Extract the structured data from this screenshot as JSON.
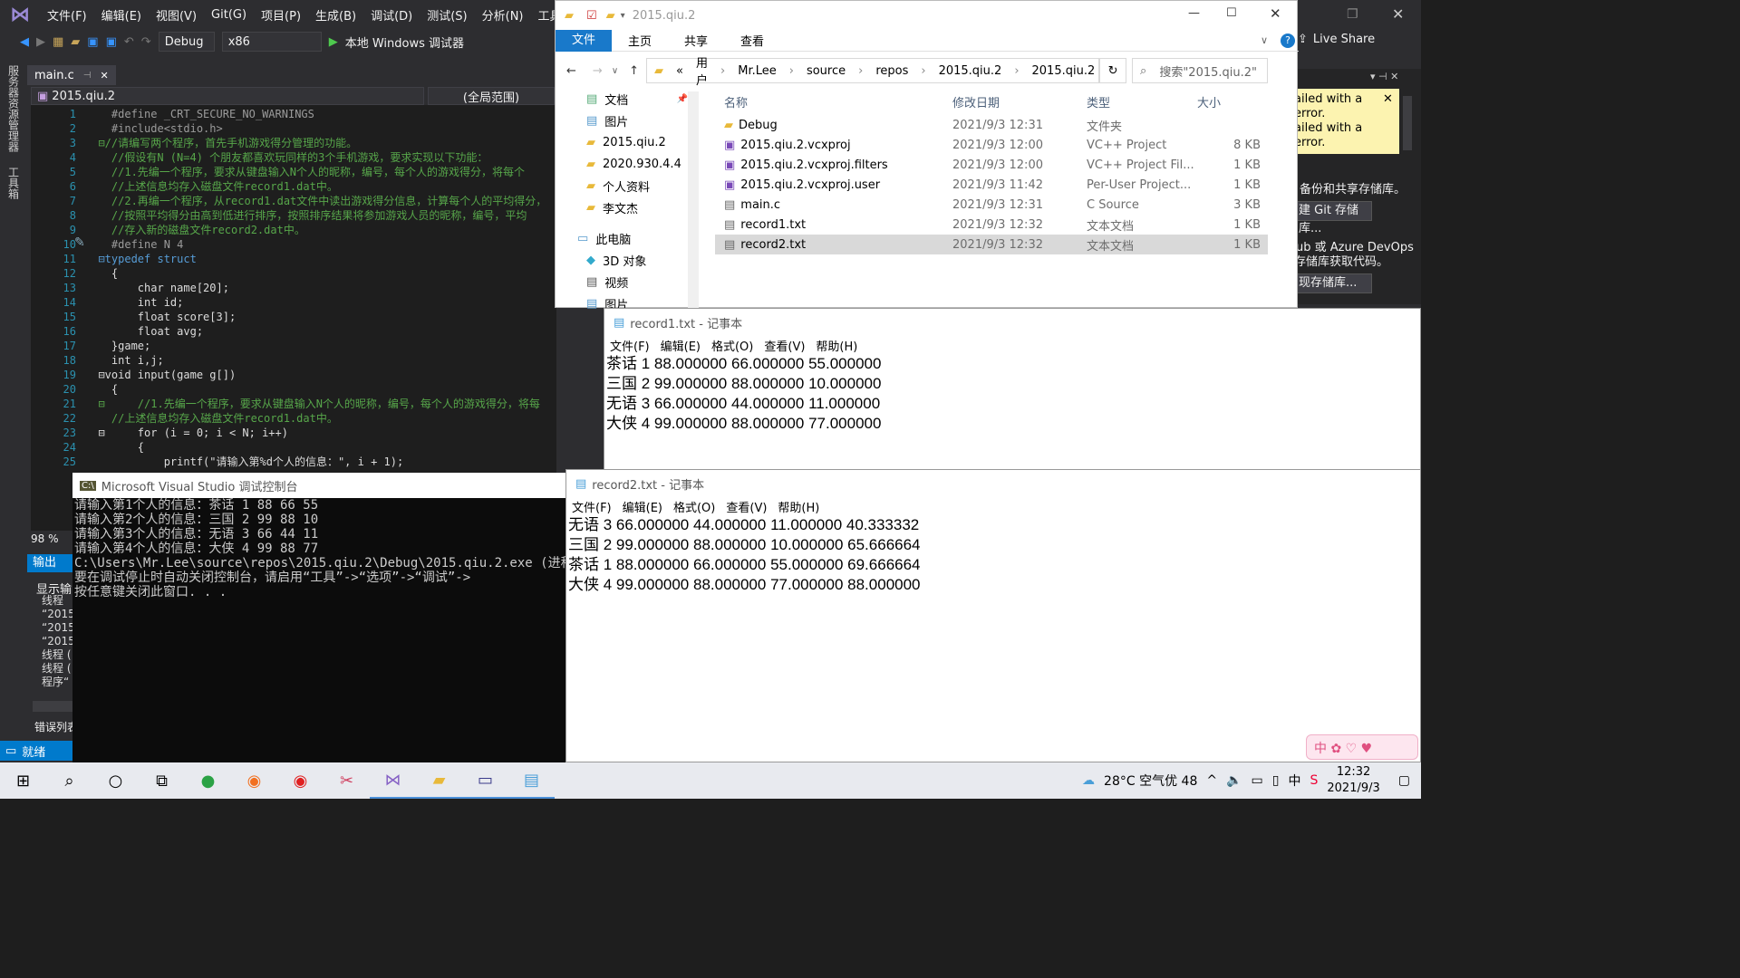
{
  "vs": {
    "menu": [
      "文件(F)",
      "编辑(E)",
      "视图(V)",
      "Git(G)",
      "项目(P)",
      "生成(B)",
      "调试(D)",
      "测试(S)",
      "分析(N)",
      "工具("
    ],
    "config": "Debug",
    "platform": "x86",
    "run_label": "本地 Windows 调试器",
    "live_share": "Live Share",
    "side_labels": [
      "服务器资源管理器",
      "工具箱"
    ],
    "tab": "main.c",
    "nav_project": "2015.qiu.2",
    "nav_scope": "(全局范围)",
    "code": [
      {
        "n": "1",
        "t": "    #define _CRT_SECURE_NO_WARNINGS",
        "c": "#9b9b9b"
      },
      {
        "n": "2",
        "t": "    #include<stdio.h>",
        "c": "#9b9b9b"
      },
      {
        "n": "3",
        "t": "  ⊟//请编写两个程序，首先手机游戏得分管理的功能。",
        "c": "#57a64a"
      },
      {
        "n": "4",
        "t": "    //假设有N (N=4) 个朋友都喜欢玩同样的3个手机游戏，要求实现以下功能：",
        "c": "#57a64a"
      },
      {
        "n": "5",
        "t": "    //1.先编一个程序，要求从键盘输入N个人的昵称，编号，每个人的游戏得分，将每个",
        "c": "#57a64a"
      },
      {
        "n": "6",
        "t": "    //上述信息均存入磁盘文件record1.dat中。",
        "c": "#57a64a"
      },
      {
        "n": "7",
        "t": "    //2.再编一个程序，从record1.dat文件中读出游戏得分信息，计算每个人的平均得分，",
        "c": "#57a64a"
      },
      {
        "n": "8",
        "t": "    //按照平均得分由高到低进行排序，按照排序结果将参加游戏人员的昵称，编号，平均",
        "c": "#57a64a"
      },
      {
        "n": "9",
        "t": "    //存入新的磁盘文件record2.dat中。",
        "c": "#57a64a"
      },
      {
        "n": "10",
        "t": "    #define N 4",
        "c": "#9b9b9b"
      },
      {
        "n": "11",
        "t": "  ⊟typedef struct",
        "c": "#569cd6"
      },
      {
        "n": "12",
        "t": "    {",
        "c": "#dcdcdc"
      },
      {
        "n": "13",
        "t": "        char name[20];",
        "c": "#dcdcdc"
      },
      {
        "n": "14",
        "t": "        int id;",
        "c": "#dcdcdc"
      },
      {
        "n": "15",
        "t": "        float score[3];",
        "c": "#dcdcdc"
      },
      {
        "n": "16",
        "t": "        float avg;",
        "c": "#dcdcdc"
      },
      {
        "n": "17",
        "t": "    }game;",
        "c": "#dcdcdc"
      },
      {
        "n": "18",
        "t": "    int i,j;",
        "c": "#dcdcdc"
      },
      {
        "n": "19",
        "t": "  ⊟void input(game g[])",
        "c": "#dcdcdc"
      },
      {
        "n": "20",
        "t": "    {",
        "c": "#dcdcdc"
      },
      {
        "n": "21",
        "t": "  ⊟     //1.先编一个程序，要求从键盘输入N个人的昵称，编号，每个人的游戏得分，将每",
        "c": "#57a64a"
      },
      {
        "n": "22",
        "t": "    //上述信息均存入磁盘文件record1.dat中。",
        "c": "#57a64a"
      },
      {
        "n": "23",
        "t": "  ⊟     for (i = 0; i < N; i++)",
        "c": "#dcdcdc"
      },
      {
        "n": "24",
        "t": "        {",
        "c": "#dcdcdc"
      },
      {
        "n": "25",
        "t": "            printf(\"请输入第%d个人的信息：\", i + 1);",
        "c": "#dcdcdc"
      }
    ],
    "zoom": "98 %",
    "output_tab": "输出",
    "output_show": "显示输出",
    "output_lines": [
      "线程",
      "“2015",
      "“2015",
      "“2015",
      "线程 (",
      "线程 (",
      "程序“"
    ],
    "error_list": "错误列表",
    "status": "就绪",
    "right_panel": [
      "ailed with a",
      "error.",
      "ailed with a",
      "error.",
      "备份和共享存储库。",
      "建 Git 存储库...",
      "ub 或 Azure DevOps",
      "存储库获取代码。",
      "现存储库..."
    ]
  },
  "explorer": {
    "title": "2015.qiu.2",
    "ribbon": [
      "文件",
      "主页",
      "共享",
      "查看"
    ],
    "breadcrumb": [
      "«",
      "用户",
      "Mr.Lee",
      "source",
      "repos",
      "2015.qiu.2",
      "2015.qiu.2"
    ],
    "search_placeholder": "搜索\"2015.qiu.2\"",
    "nav": [
      "文档",
      "图片",
      "2015.qiu.2",
      "2020.930.4.4",
      "个人资料",
      "李文杰",
      "此电脑",
      "3D 对象",
      "视频",
      "图片"
    ],
    "columns": [
      "名称",
      "修改日期",
      "类型",
      "大小"
    ],
    "files": [
      {
        "name": "Debug",
        "date": "2021/9/3 12:31",
        "type": "文件夹",
        "size": ""
      },
      {
        "name": "2015.qiu.2.vcxproj",
        "date": "2021/9/3 12:00",
        "type": "VC++ Project",
        "size": "8 KB"
      },
      {
        "name": "2015.qiu.2.vcxproj.filters",
        "date": "2021/9/3 12:00",
        "type": "VC++ Project Fil...",
        "size": "1 KB"
      },
      {
        "name": "2015.qiu.2.vcxproj.user",
        "date": "2021/9/3 11:42",
        "type": "Per-User Project...",
        "size": "1 KB"
      },
      {
        "name": "main.c",
        "date": "2021/9/3 12:31",
        "type": "C Source",
        "size": "3 KB"
      },
      {
        "name": "record1.txt",
        "date": "2021/9/3 12:32",
        "type": "文本文档",
        "size": "1 KB"
      },
      {
        "name": "record2.txt",
        "date": "2021/9/3 12:32",
        "type": "文本文档",
        "size": "1 KB"
      }
    ]
  },
  "notepad1": {
    "title": "record1.txt - 记事本",
    "menu": [
      "文件(F)",
      "编辑(E)",
      "格式(O)",
      "查看(V)",
      "帮助(H)"
    ],
    "lines": [
      "茶话 1 88.000000 66.000000 55.000000",
      "三国 2 99.000000 88.000000 10.000000",
      "无语 3 66.000000 44.000000 11.000000",
      "大侠 4 99.000000 88.000000 77.000000"
    ]
  },
  "notepad2": {
    "title": "record2.txt - 记事本",
    "menu": [
      "文件(F)",
      "编辑(E)",
      "格式(O)",
      "查看(V)",
      "帮助(H)"
    ],
    "lines": [
      "无语 3 66.000000 44.000000 11.000000 40.333332",
      "三国 2 99.000000 88.000000 10.000000 65.666664",
      "茶话 1 88.000000 66.000000 55.000000 69.666664",
      "大侠 4 99.000000 88.000000 77.000000 88.000000"
    ]
  },
  "console": {
    "title": "Microsoft Visual Studio 调试控制台",
    "lines": [
      "请输入第1个人的信息：茶话 1 88 66 55",
      "请输入第2个人的信息：三国 2 99 88 10",
      "请输入第3个人的信息：无语 3 66 44 11",
      "请输入第4个人的信息：大侠 4 99 88 77",
      "",
      "C:\\Users\\Mr.Lee\\source\\repos\\2015.qiu.2\\Debug\\2015.qiu.2.exe (进程",
      "要在调试停止时自动关闭控制台，请启用“工具”->“选项”->“调试”->",
      "按任意键关闭此窗口. . ."
    ]
  },
  "taskbar": {
    "weather": "28°C 空气优 48",
    "ime": "中",
    "time": "12:32",
    "date": "2021/9/3"
  }
}
